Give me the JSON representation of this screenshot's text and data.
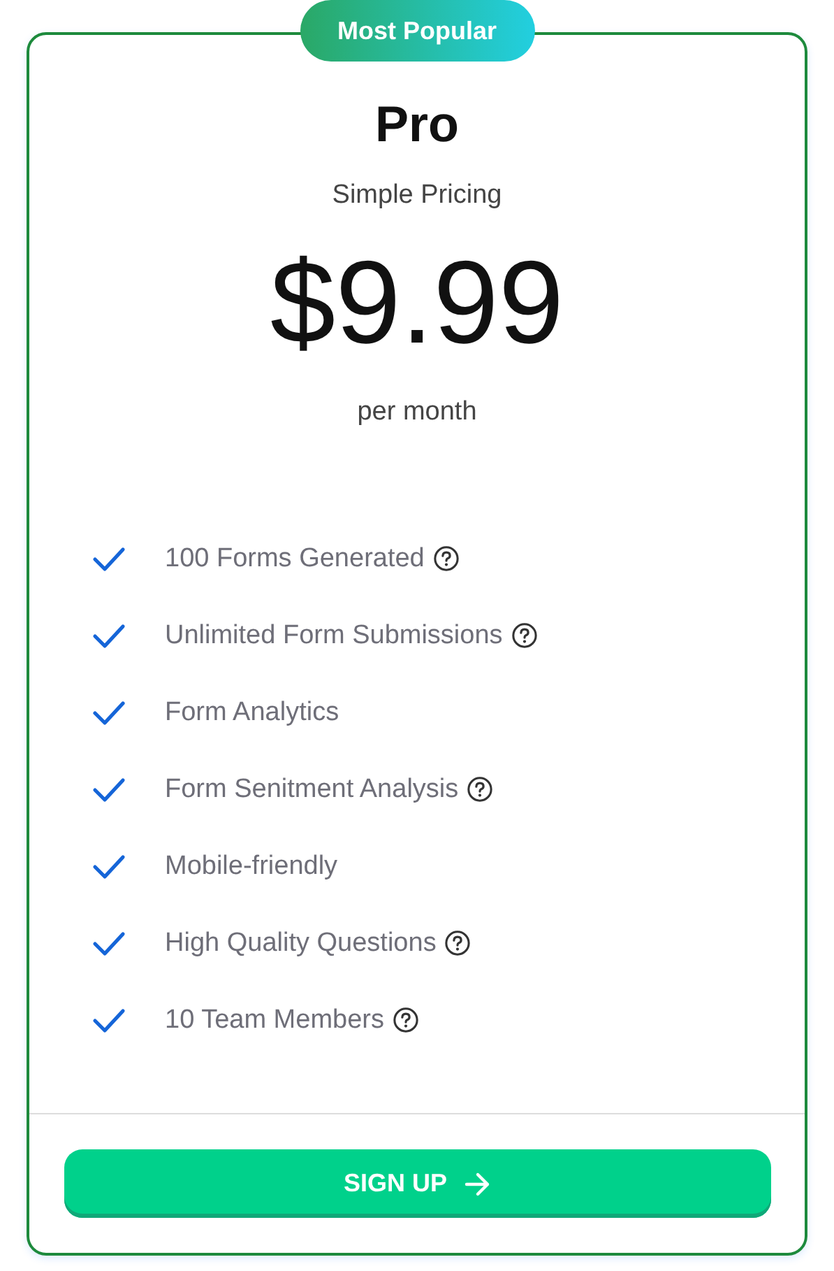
{
  "badge": "Most Popular",
  "plan": {
    "name": "Pro",
    "subtitle": "Simple Pricing",
    "price": "$9.99",
    "period": "per month"
  },
  "features": [
    {
      "label": "100 Forms Generated",
      "help": true
    },
    {
      "label": "Unlimited Form Submissions",
      "help": true
    },
    {
      "label": "Form Analytics",
      "help": false
    },
    {
      "label": "Form Senitment Analysis",
      "help": true
    },
    {
      "label": "Mobile-friendly",
      "help": false
    },
    {
      "label": "High Quality Questions",
      "help": true
    },
    {
      "label": "10 Team Members",
      "help": true
    }
  ],
  "button": {
    "label": "SIGN UP"
  }
}
